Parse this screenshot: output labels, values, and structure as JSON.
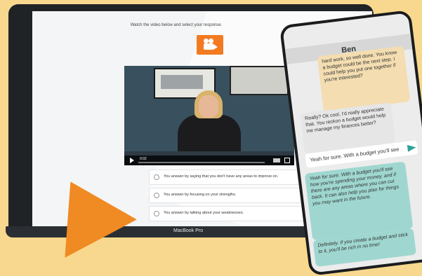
{
  "laptop": {
    "brand_label": "MacBook Pro",
    "instruction": "Watch the video below and select your response.",
    "video": {
      "time": "0:02",
      "play_icon": "play-icon",
      "fullscreen_icon": "fullscreen-icon"
    },
    "options": [
      {
        "text": "You answer by saying that you don't have any areas to improve on."
      },
      {
        "text": "You answer by focusing on your strengths."
      },
      {
        "text": "You answer by talking about your weaknesses."
      }
    ]
  },
  "phone": {
    "title": "Ben",
    "messages": [
      {
        "text": "hard work, so well done. You know a budget could be the next step. I could help you put one together if you're interested?"
      },
      {
        "text": "Really? Ok cool, I'd really appreciate that. You reckon a budget would help me manage my finances better?"
      },
      {
        "text": "Yeah for sure. With a budget you'll see how you're spending your money, and if there are any areas where you can cut back. It can also help you plan for things you may want in the future."
      },
      {
        "text": "Definitely. If you create a budget and stick to it, you'll be rich in no time!"
      }
    ],
    "input_value": "Yeah for sure. With a budget you'll see",
    "send_icon": "send-icon"
  },
  "colors": {
    "background": "#f8d88e",
    "accent_orange": "#f08a22",
    "bubble_teal": "#9fd7d0",
    "bubble_sand": "#f3ddb1"
  }
}
